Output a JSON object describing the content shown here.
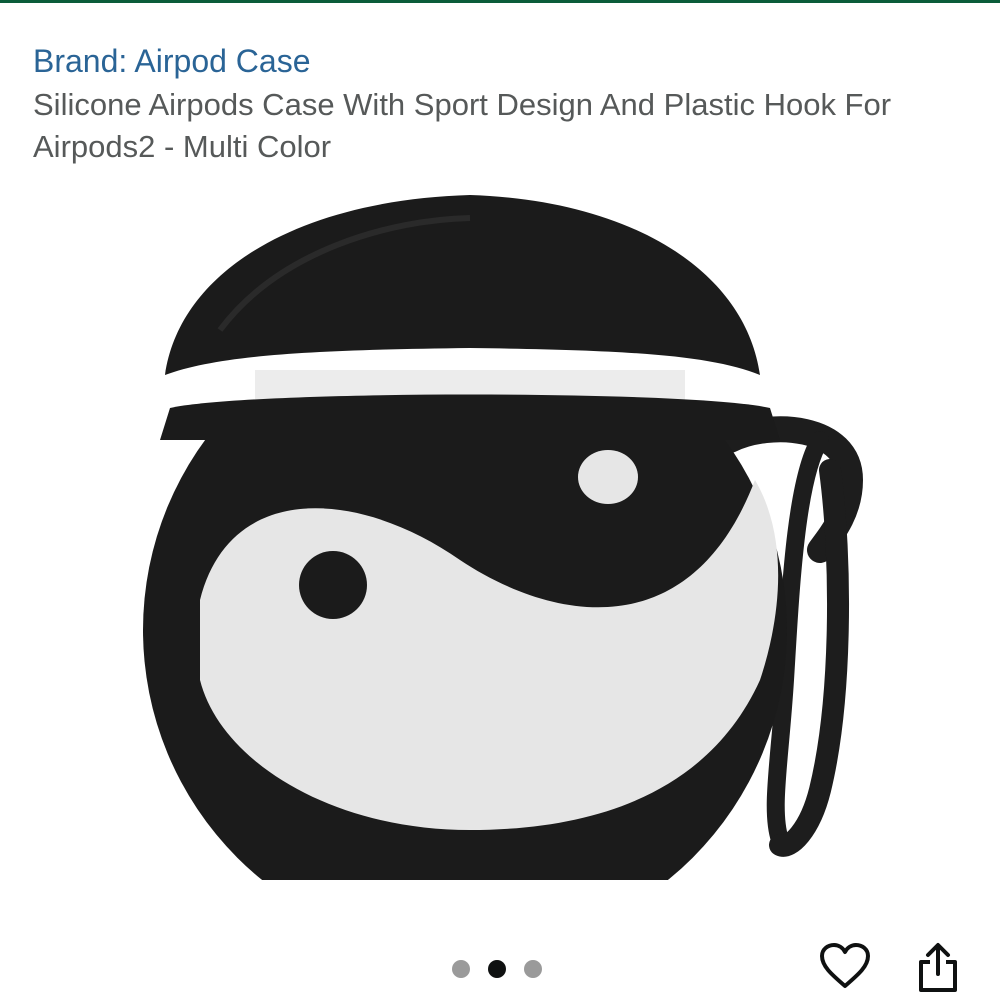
{
  "brand": {
    "label": "Brand: Airpod Case",
    "color": "#2a6496"
  },
  "product": {
    "title": "Silicone Airpods Case With Sport Design And Plastic Hook For Airpods2 - Multi Color",
    "title_color": "#565959",
    "image_icon": "yin-yang-airpods-case-image"
  },
  "carousel": {
    "dot_count": 3,
    "active_index": 1,
    "active_color": "#0f1111",
    "inactive_color": "#9a9a9a"
  },
  "actions": {
    "like_icon": "heart-icon",
    "share_icon": "share-icon",
    "icon_color": "#0f1111"
  },
  "theme": {
    "top_bar_color": "#0b5c3a"
  }
}
